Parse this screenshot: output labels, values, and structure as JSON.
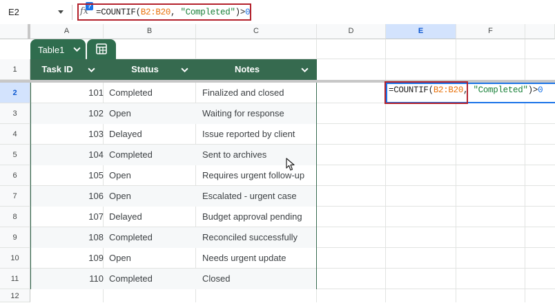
{
  "formula_bar": {
    "name_box": "E2",
    "help_badge": "?",
    "fx": "fx",
    "formula": {
      "prefix": "=COUNTIF(",
      "range": "B2:B20",
      "sep": ", ",
      "str": "\"Completed\"",
      "op": ")>",
      "num": "0"
    }
  },
  "columns": [
    "A",
    "B",
    "C",
    "D",
    "E",
    "F"
  ],
  "selected_column": "E",
  "rows": [
    "1",
    "2",
    "3",
    "4",
    "5",
    "6",
    "7",
    "8",
    "9",
    "10",
    "11",
    "12"
  ],
  "selected_row": "2",
  "table": {
    "name": "Table1",
    "headers": [
      "Task ID",
      "Status",
      "Notes"
    ],
    "data": [
      {
        "id": "101",
        "status": "Completed",
        "notes": "Finalized and closed"
      },
      {
        "id": "102",
        "status": "Open",
        "notes": "Waiting for response"
      },
      {
        "id": "103",
        "status": "Delayed",
        "notes": "Issue reported by client"
      },
      {
        "id": "104",
        "status": "Completed",
        "notes": "Sent to archives"
      },
      {
        "id": "105",
        "status": "Open",
        "notes": "Requires urgent follow-up"
      },
      {
        "id": "106",
        "status": "Open",
        "notes": "Escalated - urgent case"
      },
      {
        "id": "107",
        "status": "Delayed",
        "notes": "Budget approval pending"
      },
      {
        "id": "108",
        "status": "Completed",
        "notes": "Reconciled successfully"
      },
      {
        "id": "109",
        "status": "Open",
        "notes": "Needs urgent update"
      },
      {
        "id": "110",
        "status": "Completed",
        "notes": "Closed"
      }
    ]
  },
  "editing_cell": {
    "ref": "E2",
    "formula": {
      "prefix": "=COUNTIF(",
      "range": "B2:B20",
      "sep": ", ",
      "str": "\"Completed\"",
      "op": ")>",
      "num": "0"
    }
  },
  "colors": {
    "table_header": "#366a4f",
    "selection": "#1a73e8",
    "highlight_outline": "#b3202a",
    "range_ref": "#e8710a",
    "string_literal": "#188038"
  }
}
